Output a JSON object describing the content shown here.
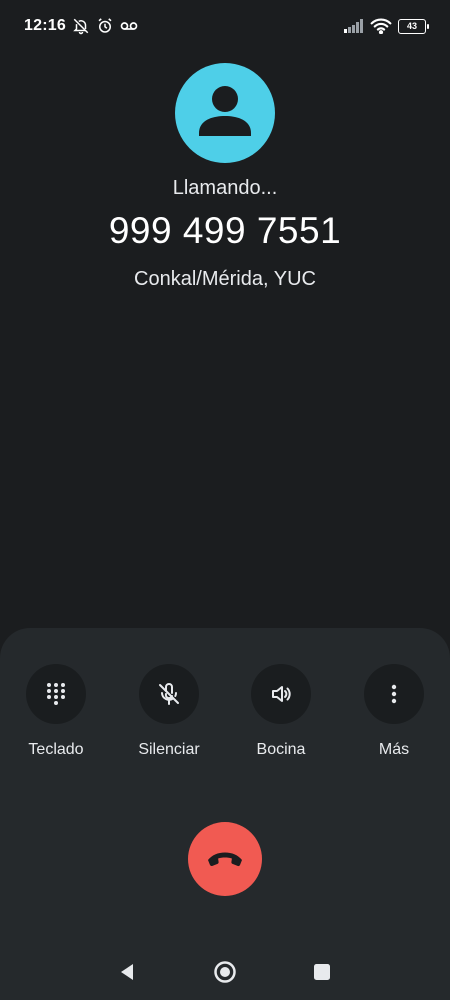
{
  "status_bar": {
    "time": "12:16",
    "battery_level": "43",
    "icons": [
      "notifications-off-icon",
      "alarm-icon",
      "voicemail-icon",
      "signal-icon",
      "wifi-icon",
      "battery-icon"
    ]
  },
  "caller": {
    "status": "Llamando...",
    "number": "999 499 7551",
    "location": "Conkal/Mérida, YUC",
    "avatar_color": "#4ecfe8"
  },
  "actions": [
    {
      "label": "Teclado",
      "icon": "dialpad-icon"
    },
    {
      "label": "Silenciar",
      "icon": "mic-off-icon"
    },
    {
      "label": "Bocina",
      "icon": "speaker-icon"
    },
    {
      "label": "Más",
      "icon": "more-vert-icon"
    }
  ],
  "end_call": {
    "icon": "call-end-icon",
    "color": "#f15a52"
  },
  "nav_bar": {
    "icons": [
      "back-icon",
      "home-icon",
      "recents-icon"
    ]
  }
}
